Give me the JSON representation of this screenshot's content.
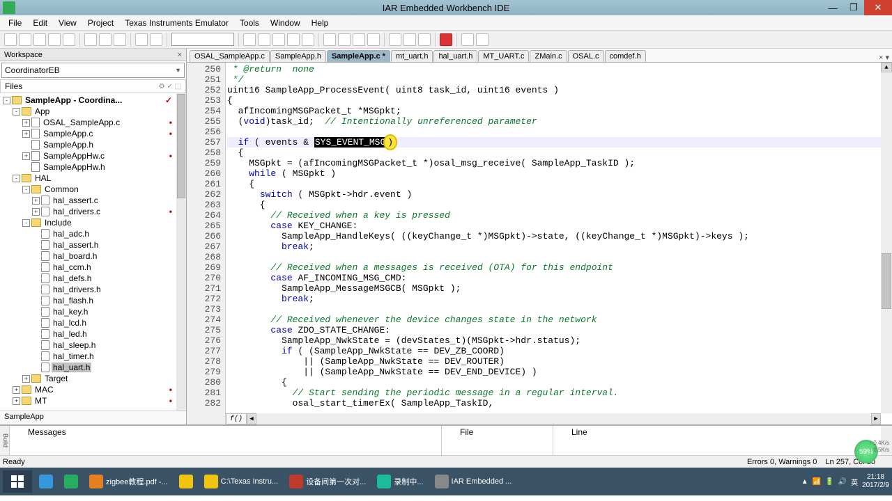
{
  "title": "IAR Embedded Workbench IDE",
  "menu": [
    "File",
    "Edit",
    "View",
    "Project",
    "Texas Instruments Emulator",
    "Tools",
    "Window",
    "Help"
  ],
  "workspace": {
    "header": "Workspace",
    "config": "CoordinatorEB",
    "filesLabel": "Files",
    "footer": "SampleApp",
    "tree": [
      {
        "d": 0,
        "t": "p",
        "exp": "-",
        "label": "SampleApp - Coordina...",
        "bold": true,
        "mark": "✓"
      },
      {
        "d": 1,
        "t": "f",
        "exp": "-",
        "label": "App"
      },
      {
        "d": 2,
        "t": "c",
        "exp": "+",
        "label": "OSAL_SampleApp.c",
        "mark": "•"
      },
      {
        "d": 2,
        "t": "c",
        "exp": "+",
        "label": "SampleApp.c",
        "mark": "•"
      },
      {
        "d": 2,
        "t": "h",
        "exp": "",
        "label": "SampleApp.h"
      },
      {
        "d": 2,
        "t": "c",
        "exp": "+",
        "label": "SampleAppHw.c",
        "mark": "•"
      },
      {
        "d": 2,
        "t": "h",
        "exp": "",
        "label": "SampleAppHw.h"
      },
      {
        "d": 1,
        "t": "f",
        "exp": "-",
        "label": "HAL"
      },
      {
        "d": 2,
        "t": "f",
        "exp": "-",
        "label": "Common"
      },
      {
        "d": 3,
        "t": "c",
        "exp": "+",
        "label": "hal_assert.c"
      },
      {
        "d": 3,
        "t": "c",
        "exp": "+",
        "label": "hal_drivers.c",
        "mark": "•"
      },
      {
        "d": 2,
        "t": "f",
        "exp": "-",
        "label": "Include"
      },
      {
        "d": 3,
        "t": "h",
        "exp": "",
        "label": "hal_adc.h"
      },
      {
        "d": 3,
        "t": "h",
        "exp": "",
        "label": "hal_assert.h"
      },
      {
        "d": 3,
        "t": "h",
        "exp": "",
        "label": "hal_board.h"
      },
      {
        "d": 3,
        "t": "h",
        "exp": "",
        "label": "hal_ccm.h"
      },
      {
        "d": 3,
        "t": "h",
        "exp": "",
        "label": "hal_defs.h"
      },
      {
        "d": 3,
        "t": "h",
        "exp": "",
        "label": "hal_drivers.h"
      },
      {
        "d": 3,
        "t": "h",
        "exp": "",
        "label": "hal_flash.h"
      },
      {
        "d": 3,
        "t": "h",
        "exp": "",
        "label": "hal_key.h"
      },
      {
        "d": 3,
        "t": "h",
        "exp": "",
        "label": "hal_lcd.h"
      },
      {
        "d": 3,
        "t": "h",
        "exp": "",
        "label": "hal_led.h"
      },
      {
        "d": 3,
        "t": "h",
        "exp": "",
        "label": "hal_sleep.h"
      },
      {
        "d": 3,
        "t": "h",
        "exp": "",
        "label": "hal_timer.h"
      },
      {
        "d": 3,
        "t": "h",
        "exp": "",
        "label": "hal_uart.h",
        "sel": true
      },
      {
        "d": 2,
        "t": "f",
        "exp": "+",
        "label": "Target"
      },
      {
        "d": 1,
        "t": "f",
        "exp": "+",
        "label": "MAC",
        "mark": "•"
      },
      {
        "d": 1,
        "t": "f",
        "exp": "+",
        "label": "MT",
        "mark": "•"
      }
    ]
  },
  "tabs": [
    {
      "label": "OSAL_SampleApp.c"
    },
    {
      "label": "SampleApp.h"
    },
    {
      "label": "SampleApp.c *",
      "active": true
    },
    {
      "label": "mt_uart.h"
    },
    {
      "label": "hal_uart.h"
    },
    {
      "label": "MT_UART.c"
    },
    {
      "label": "ZMain.c"
    },
    {
      "label": "OSAL.c"
    },
    {
      "label": "comdef.h"
    }
  ],
  "code": {
    "start": 250,
    "highlight_line": 257,
    "selected_text": "SYS_EVENT_MSG",
    "lines": [
      {
        "n": 250,
        "html": "<span class='cmt'> * @return  none</span>"
      },
      {
        "n": 251,
        "html": "<span class='cmt'> */</span>"
      },
      {
        "n": 252,
        "html": "uint16 SampleApp_ProcessEvent( uint8 task_id, uint16 events )"
      },
      {
        "n": 253,
        "html": "{"
      },
      {
        "n": 254,
        "html": "  afIncomingMSGPacket_t *MSGpkt;"
      },
      {
        "n": 255,
        "html": "  (<span class='kw'>void</span>)task_id;  <span class='cmt'>// Intentionally unreferenced parameter</span>"
      },
      {
        "n": 256,
        "html": ""
      },
      {
        "n": 257,
        "html": "  <span class='kw'>if</span> ( events &amp; <span class='sel'>SYS_EVENT_MSG</span><span class='cursor-hl'>)</span>"
      },
      {
        "n": 258,
        "html": "  {"
      },
      {
        "n": 259,
        "html": "    MSGpkt = (afIncomingMSGPacket_t *)osal_msg_receive( SampleApp_TaskID );"
      },
      {
        "n": 260,
        "html": "    <span class='kw'>while</span> ( MSGpkt )"
      },
      {
        "n": 261,
        "html": "    {"
      },
      {
        "n": 262,
        "html": "      <span class='kw'>switch</span> ( MSGpkt-&gt;hdr.event )"
      },
      {
        "n": 263,
        "html": "      {"
      },
      {
        "n": 264,
        "html": "        <span class='cmt'>// Received when a key is pressed</span>"
      },
      {
        "n": 265,
        "html": "        <span class='kw'>case</span> KEY_CHANGE:"
      },
      {
        "n": 266,
        "html": "          SampleApp_HandleKeys( ((keyChange_t *)MSGpkt)-&gt;state, ((keyChange_t *)MSGpkt)-&gt;keys );"
      },
      {
        "n": 267,
        "html": "          <span class='kw'>break</span>;"
      },
      {
        "n": 268,
        "html": ""
      },
      {
        "n": 269,
        "html": "        <span class='cmt'>// Received when a messages is received (OTA) for this endpoint</span>"
      },
      {
        "n": 270,
        "html": "        <span class='kw'>case</span> AF_INCOMING_MSG_CMD:"
      },
      {
        "n": 271,
        "html": "          SampleApp_MessageMSGCB( MSGpkt );"
      },
      {
        "n": 272,
        "html": "          <span class='kw'>break</span>;"
      },
      {
        "n": 273,
        "html": ""
      },
      {
        "n": 274,
        "html": "        <span class='cmt'>// Received whenever the device changes state in the network</span>"
      },
      {
        "n": 275,
        "html": "        <span class='kw'>case</span> ZDO_STATE_CHANGE:"
      },
      {
        "n": 276,
        "html": "          SampleApp_NwkState = (devStates_t)(MSGpkt-&gt;hdr.status);"
      },
      {
        "n": 277,
        "html": "          <span class='kw'>if</span> ( (SampleApp_NwkState == DEV_ZB_COORD)"
      },
      {
        "n": 278,
        "html": "              || (SampleApp_NwkState == DEV_ROUTER)"
      },
      {
        "n": 279,
        "html": "              || (SampleApp_NwkState == DEV_END_DEVICE) )"
      },
      {
        "n": 280,
        "html": "          {"
      },
      {
        "n": 281,
        "html": "            <span class='cmt'>// Start sending the periodic message in a regular interval.</span>"
      },
      {
        "n": 282,
        "html": "            osal_start_timerEx( SampleApp_TaskID,"
      }
    ]
  },
  "messages": {
    "hdr1": "Messages",
    "hdr2": "File",
    "hdr3": "Line",
    "side": "Build"
  },
  "status": {
    "ready": "Ready",
    "errors": "Errors 0, Warnings 0",
    "pos": "Ln 257, Col 30"
  },
  "taskbar": {
    "items": [
      {
        "cls": "blue",
        "label": ""
      },
      {
        "cls": "green",
        "label": ""
      },
      {
        "cls": "orange",
        "label": "zigbee教程.pdf -..."
      },
      {
        "cls": "yellow",
        "label": ""
      },
      {
        "cls": "yellow",
        "label": "C:\\Texas Instru..."
      },
      {
        "cls": "pp",
        "label": "设备间第一次对..."
      },
      {
        "cls": "cam",
        "label": "录制中..."
      },
      {
        "cls": "",
        "label": "IAR Embedded ..."
      }
    ],
    "time": "21:18",
    "date": "2017/2/9",
    "ime": "英"
  },
  "float": {
    "pct": "59%",
    "up": "0.4K/s",
    "down": "0.5K/s"
  }
}
